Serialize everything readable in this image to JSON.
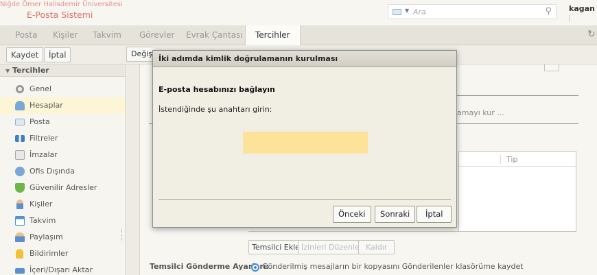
{
  "header": {
    "org_name": "Niğde Ömer Halisdemir Üniversitesi",
    "app_name": "E-Posta Sistemi",
    "search_placeholder": "Ara",
    "username": "kagan"
  },
  "tabs": [
    {
      "label": "Posta"
    },
    {
      "label": "Kişiler"
    },
    {
      "label": "Takvim"
    },
    {
      "label": "Görevler"
    },
    {
      "label": "Evrak Çantası"
    },
    {
      "label": "Tercihler"
    }
  ],
  "toolbar": {
    "save_label": "Kaydet",
    "cancel_label": "İptal",
    "change_label": "Değişik"
  },
  "sidebar": {
    "header": "Tercihler",
    "items": [
      {
        "label": "Genel",
        "icon": "gear-icon"
      },
      {
        "label": "Hesaplar",
        "icon": "accounts-icon"
      },
      {
        "label": "Posta",
        "icon": "mail-icon"
      },
      {
        "label": "Filtreler",
        "icon": "filter-icon"
      },
      {
        "label": "İmzalar",
        "icon": "signature-icon"
      },
      {
        "label": "Ofis Dışında",
        "icon": "out-of-office-icon"
      },
      {
        "label": "Güvenilir Adresler",
        "icon": "shield-icon"
      },
      {
        "label": "Kişiler",
        "icon": "contacts-icon"
      },
      {
        "label": "Takvim",
        "icon": "calendar-icon"
      },
      {
        "label": "Paylaşım",
        "icon": "sharing-icon"
      },
      {
        "label": "Bildirimler",
        "icon": "notifications-icon"
      },
      {
        "label": "İçeri/Dışarı Aktar",
        "icon": "import-export-icon"
      }
    ]
  },
  "background": {
    "setup_link_partial": "amayı kur ...",
    "table_col_type": "Tip",
    "add_delegate": "Temsilci Ekle",
    "edit_permissions": "İzinleri Düzenle",
    "remove": "Kaldır",
    "delegate_settings_label": "Temsilci Gönderme Ayarları:",
    "radio_label": "Gönderilmiş mesajların bir kopyasını Gönderilenler klasörüme kaydet"
  },
  "modal": {
    "title": "İki adımda kimlik doğrulamanın kurulması",
    "heading": "E-posta hesabınızı bağlayın",
    "prompt": "İstendiğinde şu anahtarı girin:",
    "key_value": "",
    "prev_label": "Önceki",
    "next_label": "Sonraki",
    "cancel_label": "İptal"
  },
  "colors": {
    "selected_row": "#fcf6d6",
    "key_box": "#fde39a",
    "brand": "#e0706a",
    "radio": "#3b8bd8"
  }
}
